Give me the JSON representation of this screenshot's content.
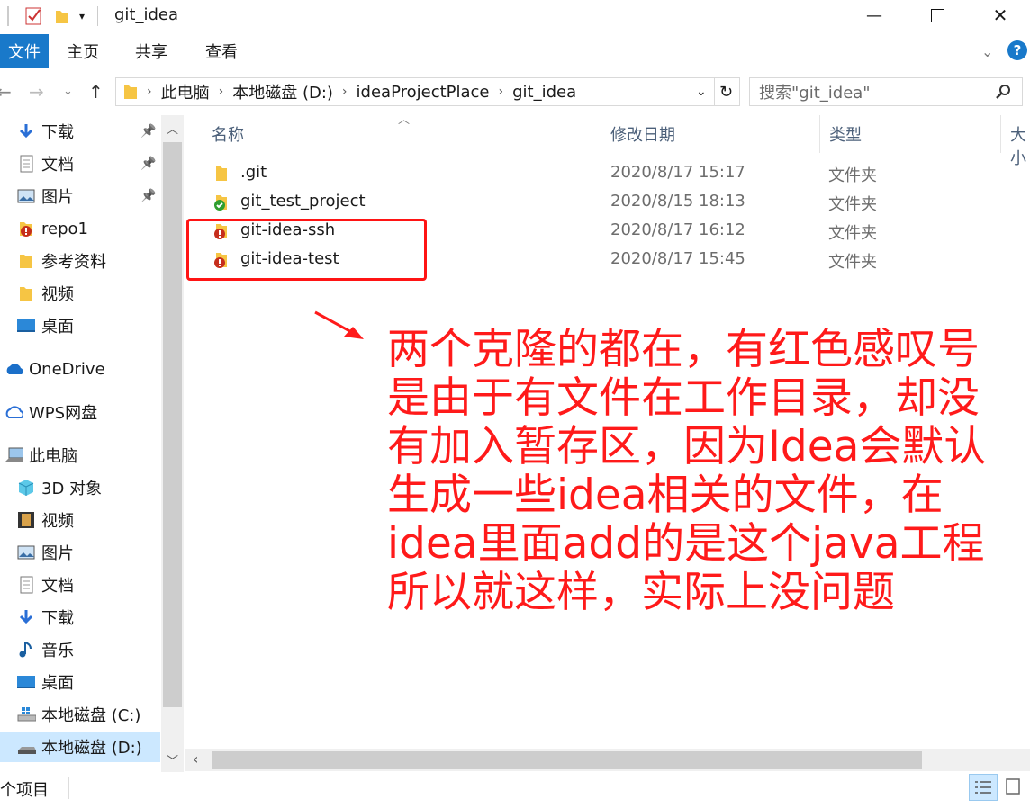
{
  "window": {
    "title": "git_idea",
    "minimize_glyph": "—",
    "maximize_glyph": "☐",
    "close_glyph": "✕"
  },
  "ribbon": {
    "tabs": [
      "文件",
      "主页",
      "共享",
      "查看"
    ],
    "help_glyph": "?"
  },
  "address": {
    "crumbs": [
      "此电脑",
      "本地磁盘 (D:)",
      "ideaProjectPlace",
      "git_idea"
    ],
    "search_placeholder": "搜索\"git_idea\""
  },
  "nav": {
    "items": [
      {
        "label": "下载",
        "icon": "download-arrow-icon",
        "pinned": true
      },
      {
        "label": "文档",
        "icon": "document-icon",
        "pinned": true
      },
      {
        "label": "图片",
        "icon": "pictures-icon",
        "pinned": true
      },
      {
        "label": "repo1",
        "icon": "git-modified-folder-icon",
        "pinned": false
      },
      {
        "label": "参考资料",
        "icon": "folder-icon",
        "pinned": false
      },
      {
        "label": "视频",
        "icon": "folder-icon",
        "pinned": false
      },
      {
        "label": "桌面",
        "icon": "desktop-icon",
        "pinned": false
      },
      {
        "label": "OneDrive",
        "icon": "cloud-icon",
        "pinned": false
      },
      {
        "label": "WPS网盘",
        "icon": "cloud-outline-icon",
        "pinned": false
      },
      {
        "label": "此电脑",
        "icon": "computer-icon",
        "pinned": false
      },
      {
        "label": "3D 对象",
        "icon": "cube-icon",
        "pinned": false
      },
      {
        "label": "视频",
        "icon": "film-icon",
        "pinned": false
      },
      {
        "label": "图片",
        "icon": "pictures-icon",
        "pinned": false
      },
      {
        "label": "文档",
        "icon": "document-icon",
        "pinned": false
      },
      {
        "label": "下载",
        "icon": "download-arrow-icon",
        "pinned": false
      },
      {
        "label": "音乐",
        "icon": "music-note-icon",
        "pinned": false
      },
      {
        "label": "桌面",
        "icon": "desktop-icon",
        "pinned": false
      },
      {
        "label": "本地磁盘 (C:)",
        "icon": "windows-drive-icon",
        "pinned": false
      },
      {
        "label": "本地磁盘 (D:)",
        "icon": "drive-icon",
        "pinned": false,
        "selected": true
      }
    ]
  },
  "columns": {
    "name": "名称",
    "date": "修改日期",
    "type": "类型",
    "size": "大小"
  },
  "files": [
    {
      "name": ".git",
      "date": "2020/8/17 15:17",
      "type": "文件夹",
      "status": "plain"
    },
    {
      "name": "git_test_project",
      "date": "2020/8/15 18:13",
      "type": "文件夹",
      "status": "clean"
    },
    {
      "name": "git-idea-ssh",
      "date": "2020/8/17 16:12",
      "type": "文件夹",
      "status": "modified"
    },
    {
      "name": "git-idea-test",
      "date": "2020/8/17 15:45",
      "type": "文件夹",
      "status": "modified"
    }
  ],
  "annotation": {
    "lines": [
      "两个克隆的都在，有红色感叹号",
      "是由于有文件在工作目录，却没",
      "有加入暂存区，因为Idea会默认",
      "生成一些idea相关的文件，在",
      "idea里面add的是这个java工程",
      "所以就这样，实际上没问题"
    ],
    "color": "#ff1a1a"
  },
  "status": {
    "item_count": "个项目"
  },
  "colors": {
    "accent": "#1979ca",
    "selection": "#cce8ff",
    "highlight_box": "#ff1414"
  }
}
